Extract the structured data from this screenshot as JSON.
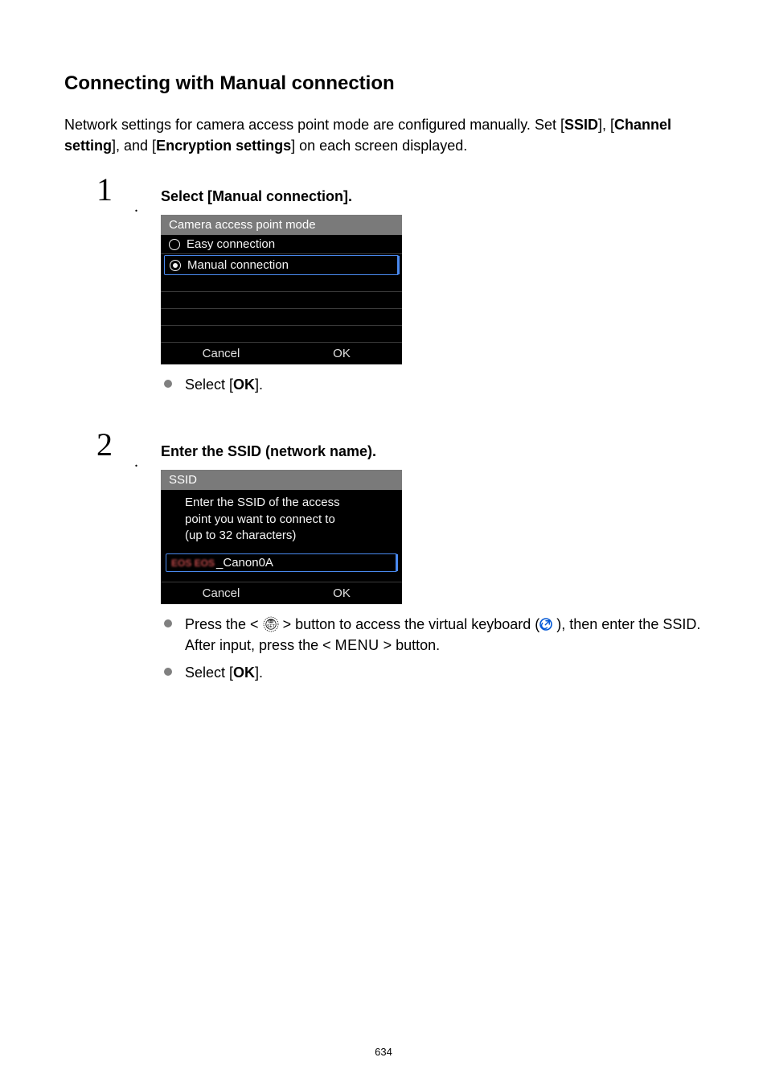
{
  "title": "Connecting with Manual connection",
  "intro": {
    "t1": "Network settings for camera access point mode are configured manually. Set [",
    "b1": "SSID",
    "t2": "], [",
    "b2": "Channel setting",
    "t3": "], and [",
    "b3": "Encryption settings",
    "t4": "] on each screen displayed."
  },
  "steps": {
    "s1": {
      "num": "1",
      "head": "Select [Manual connection].",
      "shot": {
        "title": "Camera access point mode",
        "opt1": "Easy connection",
        "opt2": "Manual connection",
        "cancel": "Cancel",
        "ok": "OK"
      },
      "sub": {
        "a_pre": "Select [",
        "a_b": "OK",
        "a_post": "]."
      }
    },
    "s2": {
      "num": "2",
      "head": "Enter the SSID (network name).",
      "shot": {
        "title": "SSID",
        "instr_l1": "Enter the SSID of the access",
        "instr_l2": "point you want to connect to",
        "instr_l3": "(up to 32 characters)",
        "ssid_prefix": "EOS EOS",
        "ssid_value": "_Canon0A",
        "cancel": "Cancel",
        "ok": "OK"
      },
      "sub": {
        "a_pre": "Press the < ",
        "a_mid1": " > button to access the virtual keyboard (",
        "a_mid2": " ), then enter the SSID. After input, press the < ",
        "a_menu": "MENU",
        "a_post": " > button.",
        "b_pre": "Select [",
        "b_b": "OK",
        "b_post": "]."
      }
    }
  },
  "page_number": "634"
}
